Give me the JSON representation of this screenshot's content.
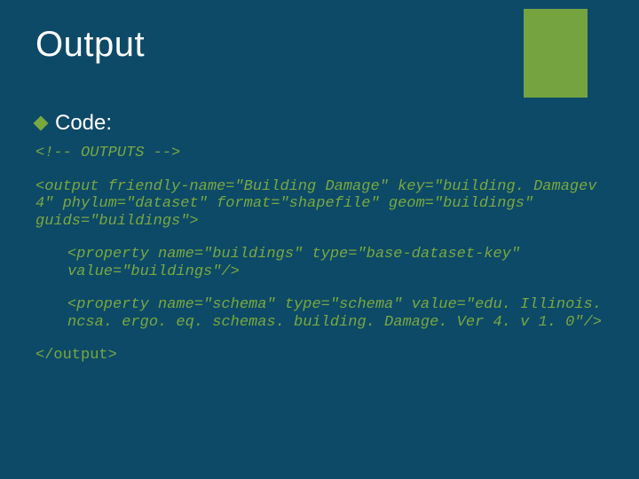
{
  "slide": {
    "title": "Output",
    "bullet": "Code:",
    "code": {
      "l1": "<!-- OUTPUTS -->",
      "l2": "<output friendly-name=\"Building Damage\" key=\"building. Damagev 4\" phylum=\"dataset\" format=\"shapefile\" geom=\"buildings\" guids=\"buildings\">",
      "l3": "<property name=\"buildings\" type=\"base-dataset-key\" value=\"buildings\"/>",
      "l4": "<property name=\"schema\" type=\"schema\" value=\"edu. Illinois. ncsa. ergo. eq. schemas. building. Damage. Ver 4. v 1. 0\"/>",
      "l5": "</output>"
    }
  }
}
